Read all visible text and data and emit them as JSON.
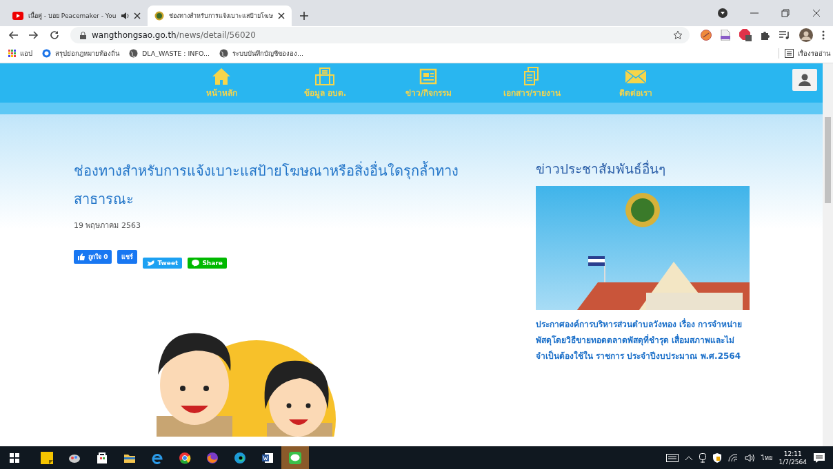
{
  "browser": {
    "tabs": [
      {
        "title": "เนื้อคู่ - บอย Peacemaker - You",
        "selected": false,
        "audio": true
      },
      {
        "title": "ช่องทางสำหรับการแจ้งเบาะแสป้ายโฆษ",
        "selected": true,
        "audio": false
      }
    ],
    "address": {
      "domain": "wangthongsao.go.th",
      "path": "/news/detail/56020"
    },
    "bookmarks": [
      {
        "label": "แอป",
        "kind": "apps"
      },
      {
        "label": "สรุปย่อกฎหมายท้องถิ่น",
        "kind": "site"
      },
      {
        "label": "DLA_WASTE : INFO...",
        "kind": "globe"
      },
      {
        "label": "ระบบบันทึกบัญชีขององ...",
        "kind": "globe"
      }
    ],
    "reading_list": "เรื่องรออ่าน"
  },
  "nav": [
    {
      "label": "หน้าหลัก",
      "kind": "home"
    },
    {
      "label": "ข้อมูล อบต.",
      "kind": "building"
    },
    {
      "label": "ข่าว/กิจกรรม",
      "kind": "news"
    },
    {
      "label": "เอกสาร/รายงาน",
      "kind": "docs"
    },
    {
      "label": "ติดต่อเรา",
      "kind": "mail"
    }
  ],
  "article": {
    "title": "ช่องทางสำหรับการแจ้งเบาะแสป้ายโฆษณาหรือสิ่งอื่นใดรุกล้ำทาง สาธารณะ",
    "date": "19 พฤษภาคม 2563",
    "social": [
      {
        "label": "ถูกใจ 0",
        "kind": "like"
      },
      {
        "label": "แชร์",
        "kind": "fbshare"
      },
      {
        "label": "Tweet",
        "kind": "tweet"
      },
      {
        "label": "Share",
        "kind": "line"
      }
    ]
  },
  "sidebar": {
    "heading": "ข่าวประชาสัมพันธ์อื่นๆ",
    "news": [
      {
        "title": "ประกาศองค์การบริหารส่วนตำบลวังทอง เรื่อง การจำหน่ายพัสดุโดยวิธีขายทอดตลาดพัสดุที่ชำรุด เสื่อมสภาพและไม่จำเป็นต้องใช้ใน ราชการ ประจำปีงบประมาณ พ.ศ.2564"
      }
    ]
  },
  "taskbar": {
    "language": "ไทย",
    "time": "12:11",
    "date": "1/7/2564"
  }
}
